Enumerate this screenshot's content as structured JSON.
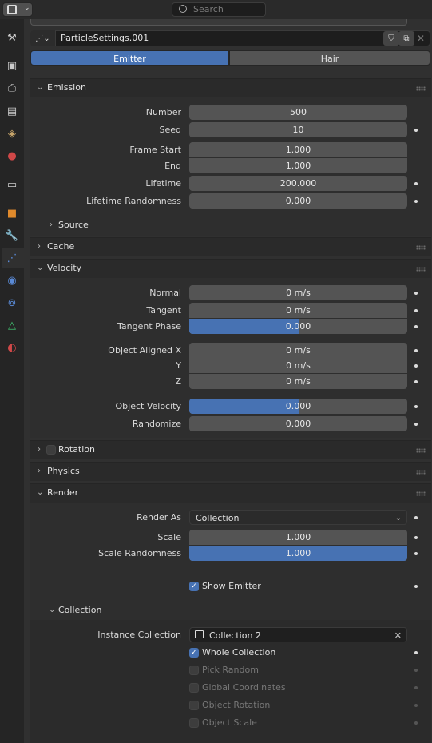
{
  "header": {
    "search_placeholder": "Search",
    "editor_type_icon": "properties-editor-icon"
  },
  "sidebar": {
    "tabs": [
      "tool-icon",
      "render-icon",
      "output-icon",
      "view-layer-icon",
      "scene-icon",
      "world-icon",
      "collection-icon",
      "object-icon",
      "modifier-icon",
      "particles-icon",
      "physics-icon",
      "constraints-icon",
      "data-icon",
      "material-icon"
    ],
    "active": "particles-icon"
  },
  "particle_settings": {
    "name": "ParticleSettings.001",
    "type_tabs": [
      "Emitter",
      "Hair"
    ],
    "active_tab": "Emitter"
  },
  "emission": {
    "title": "Emission",
    "number": {
      "label": "Number",
      "value": "500"
    },
    "seed": {
      "label": "Seed",
      "value": "10"
    },
    "frame_start": {
      "label": "Frame Start",
      "value": "1.000"
    },
    "end": {
      "label": "End",
      "value": "1.000"
    },
    "lifetime": {
      "label": "Lifetime",
      "value": "200.000"
    },
    "lifetime_randomness": {
      "label": "Lifetime Randomness",
      "value": "0.000"
    },
    "source": "Source"
  },
  "cache": {
    "title": "Cache"
  },
  "velocity": {
    "title": "Velocity",
    "normal": {
      "label": "Normal",
      "value": "0 m/s"
    },
    "tangent": {
      "label": "Tangent",
      "value": "0 m/s"
    },
    "tangent_phase": {
      "label": "Tangent Phase",
      "value": "0.000",
      "fill": 0.5
    },
    "obj_aligned_x": {
      "label": "Object Aligned X",
      "value": "0 m/s"
    },
    "obj_aligned_y": {
      "label": "Y",
      "value": "0 m/s"
    },
    "obj_aligned_z": {
      "label": "Z",
      "value": "0 m/s"
    },
    "object_velocity": {
      "label": "Object Velocity",
      "value": "0.000",
      "fill": 0.5
    },
    "randomize": {
      "label": "Randomize",
      "value": "0.000"
    }
  },
  "rotation": {
    "title": "Rotation",
    "enabled": false
  },
  "physics": {
    "title": "Physics"
  },
  "render": {
    "title": "Render",
    "render_as": {
      "label": "Render As",
      "value": "Collection"
    },
    "scale": {
      "label": "Scale",
      "value": "1.000"
    },
    "scale_randomness": {
      "label": "Scale Randomness",
      "value": "1.000",
      "fill": 1.0
    },
    "show_emitter": {
      "label": "Show Emitter",
      "checked": true
    },
    "collection": {
      "title": "Collection",
      "instance_collection": {
        "label": "Instance Collection",
        "value": "Collection 2"
      },
      "whole_collection": {
        "label": "Whole Collection",
        "checked": true
      },
      "pick_random": {
        "label": "Pick Random",
        "checked": false
      },
      "global_coordinates": {
        "label": "Global Coordinates",
        "checked": false
      },
      "object_rotation": {
        "label": "Object Rotation",
        "checked": false
      },
      "object_scale": {
        "label": "Object Scale",
        "checked": false
      }
    }
  }
}
